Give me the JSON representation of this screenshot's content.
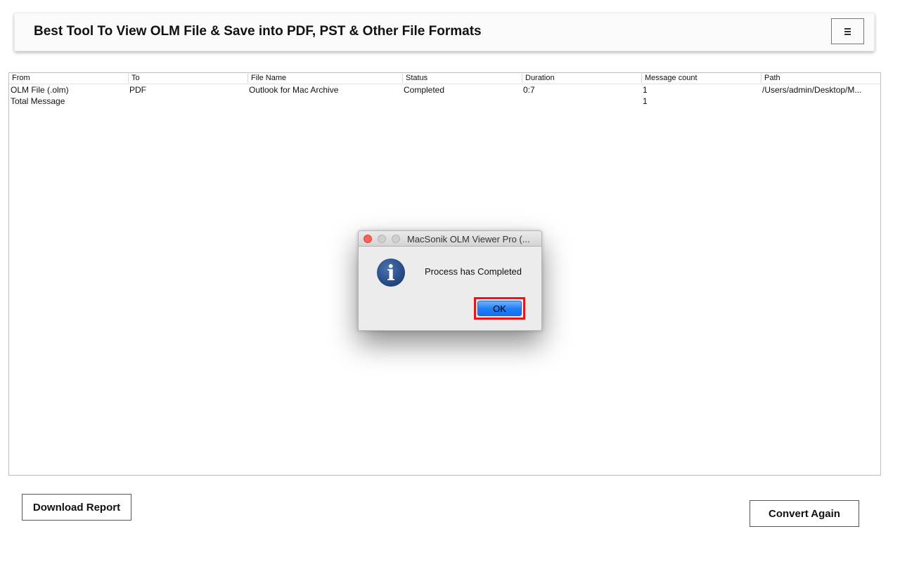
{
  "header": {
    "title": "Best Tool To View OLM File & Save into PDF, PST & Other File Formats",
    "menu_icon": "hamburger-menu-icon"
  },
  "table": {
    "columns": [
      "From",
      "To",
      "File Name",
      "Status",
      "Duration",
      "Message count",
      "Path"
    ],
    "rows": [
      [
        "OLM File (.olm)",
        "PDF",
        "Outlook for Mac Archive",
        "Completed",
        "0:7",
        "1",
        "/Users/admin/Desktop/M..."
      ],
      [
        "Total Message",
        "",
        "",
        "",
        "",
        "1",
        ""
      ]
    ]
  },
  "buttons": {
    "download_report": "Download Report",
    "convert_again": "Convert Again"
  },
  "dialog": {
    "title": "MacSonik OLM Viewer Pro (...",
    "message": "Process has Completed",
    "ok_label": "OK",
    "icon": "info-icon",
    "icon_glyph": "i",
    "highlight_color": "#e8141e",
    "button_color": "#1f7cf6"
  }
}
